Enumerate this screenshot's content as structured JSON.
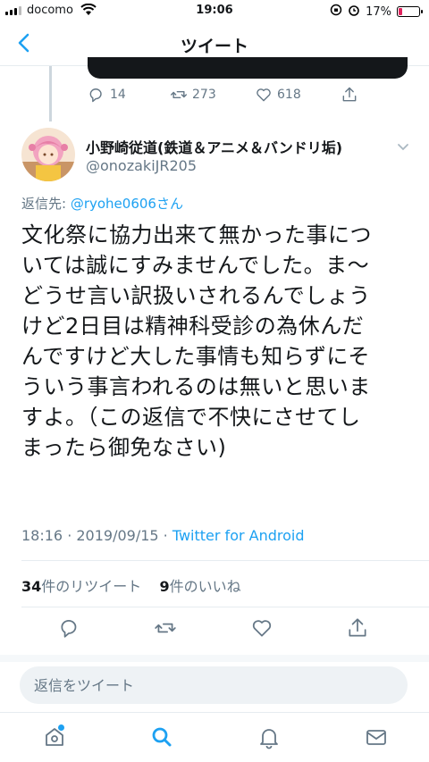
{
  "status_bar": {
    "carrier": "docomo",
    "time": "19:06",
    "battery": "17%",
    "battery_level": 0.17
  },
  "header": {
    "title": "ツイート"
  },
  "previous_tweet": {
    "reply_count": "14",
    "retweet_count": "273",
    "like_count": "618"
  },
  "tweet": {
    "author_name": "小野崎従道(鉄道＆アニメ＆バンドリ垢)",
    "author_handle": "@onozakiJR205",
    "reply_prefix": "返信先: ",
    "reply_mention": "@ryohe0606",
    "reply_suffix": "さん",
    "text": "文化祭に協力出来て無かった事につ\nいては誠にすみませんでした。ま〜\nどうせ言い訳扱いされるんでしょう\nけど2日目は精神科受診の為休んだ\nんですけど大した事情も知らずにそ\nういう事言われるのは無いと思いま\nすよ。（この返信で不快にさせてし\nまったら御免なさい)",
    "timestamp": "18:16 · 2019/09/15 · ",
    "source": "Twitter for Android",
    "retweets_count": "34",
    "retweets_label": "件のリツイート",
    "likes_count": "9",
    "likes_label": "件のいいね"
  },
  "reply_input": {
    "placeholder": "返信をツイート"
  },
  "accent_color": "#1da1f2",
  "icons": [
    "back-icon",
    "reply-icon",
    "retweet-icon",
    "like-icon",
    "share-icon",
    "chevron-down-icon",
    "home-icon",
    "search-icon",
    "notifications-icon",
    "messages-icon"
  ]
}
